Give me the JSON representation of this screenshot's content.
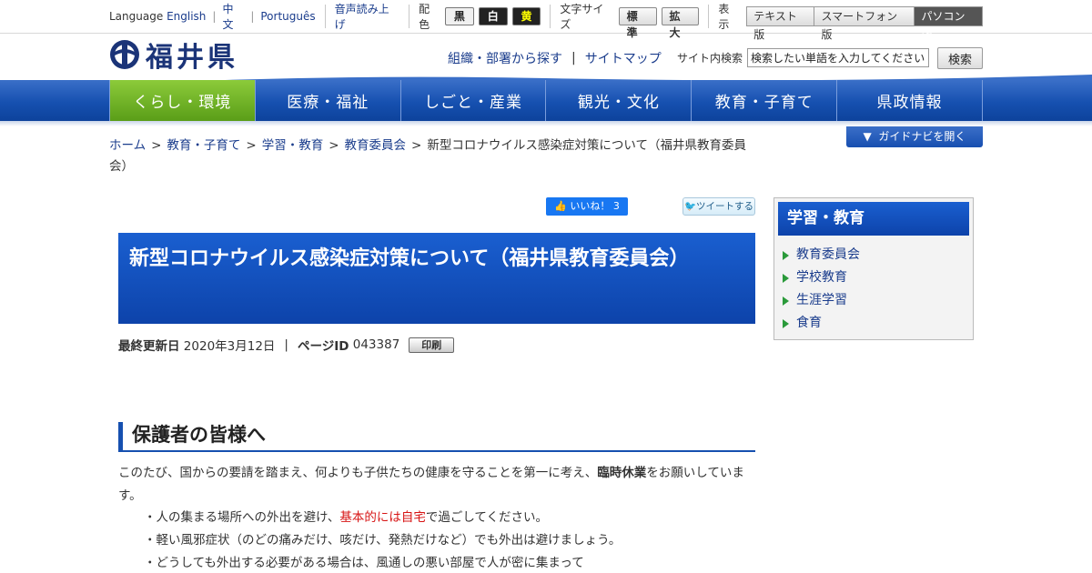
{
  "utility": {
    "language_label": "Language",
    "lang_english": "English",
    "lang_chinese": "中文",
    "lang_portuguese": "Português",
    "voice_read": "音声読み上げ",
    "color_label": "配色",
    "color_black": "黒",
    "color_white": "白",
    "color_yellow": "黄",
    "fontsize_label": "文字サイズ",
    "fontsize_standard": "標準",
    "fontsize_large": "拡大",
    "display_label": "表示",
    "view_text": "テキスト版",
    "view_smartphone": "スマートフォン版",
    "view_pc": "パソコン版"
  },
  "header": {
    "logo_text": "福井県",
    "link_org": "組織・部署から探す",
    "link_sitemap": "サイトマップ",
    "search_label": "サイト内検索",
    "search_placeholder": "検索したい単語を入力してください",
    "search_button": "検索"
  },
  "nav": {
    "items": [
      {
        "label": "くらし・環境"
      },
      {
        "label": "医療・福祉"
      },
      {
        "label": "しごと・産業"
      },
      {
        "label": "観光・文化"
      },
      {
        "label": "教育・子育て"
      },
      {
        "label": "県政情報"
      }
    ],
    "guide_button": "ガイドナビを開く"
  },
  "breadcrumb": {
    "items": [
      "ホーム",
      "教育・子育て",
      "学習・教育",
      "教育委員会"
    ],
    "current": "新型コロナウイルス感染症対策について（福井県教育委員会）"
  },
  "social": {
    "facebook_label": "いいね！ 3",
    "twitter_label": "ツイートする"
  },
  "page": {
    "title": "新型コロナウイルス感染症対策について（福井県教育委員会）",
    "updated_label": "最終更新日",
    "updated_value": "2020年3月12日",
    "pageid_label": "ページID",
    "pageid_value": "043387",
    "print_button": "印刷"
  },
  "section": {
    "heading": "保護者の皆様へ",
    "intro_before": "このたび、国からの要請を踏まえ、何よりも子供たちの健康を守ることを第一に考え、",
    "intro_bold": "臨時休業",
    "intro_after": "をお願いしています。",
    "bullet1_before": "・人の集まる場所への外出を避け、",
    "bullet1_red": "基本的には自宅",
    "bullet1_after": "で過ごしてください。",
    "bullet2": "・軽い風邪症状（のどの痛みだけ、咳だけ、発熱だけなど）でも外出は避けましょう。",
    "bullet3": "・どうしても外出する必要がある場合は、風通しの悪い部屋で人が密に集まって"
  },
  "sidebar": {
    "title": "学習・教育",
    "items": [
      {
        "label": "教育委員会"
      },
      {
        "label": "学校教育"
      },
      {
        "label": "生涯学習"
      },
      {
        "label": "食育"
      }
    ]
  },
  "colors": {
    "brand_blue": "#1650b0",
    "nav_active_green": "#6db22a",
    "highlight_red": "#d71414"
  }
}
